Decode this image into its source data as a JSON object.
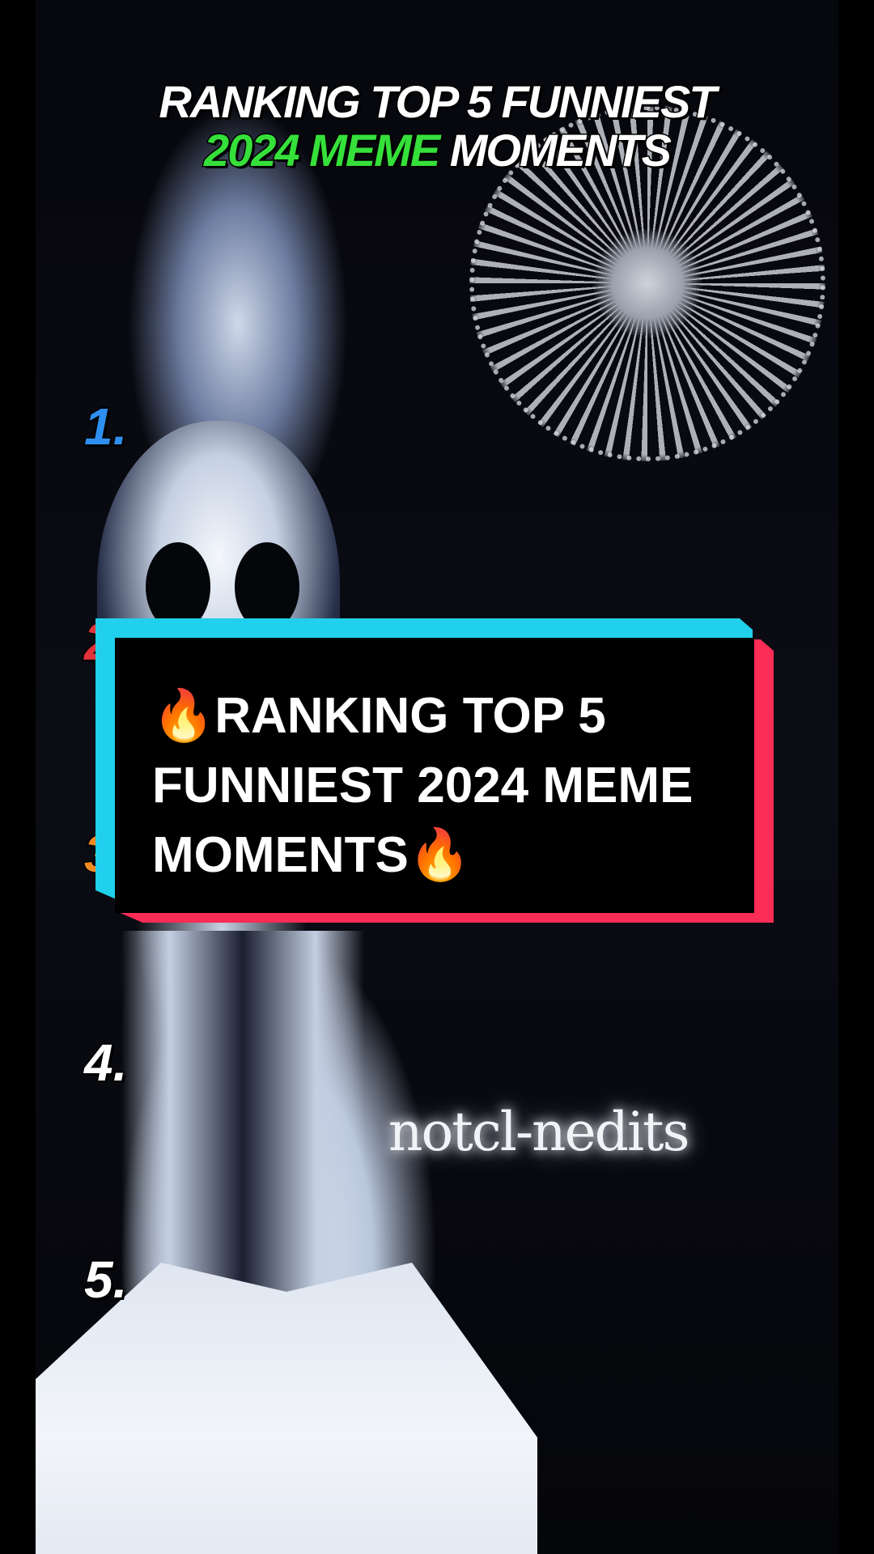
{
  "header": {
    "line1": "RANKING TOP 5 FUNNIEST",
    "line2_highlight": "2024 MEME",
    "line2_rest": " MOMENTS"
  },
  "ranks": [
    "1.",
    "2",
    "3",
    "4.",
    "5."
  ],
  "caption": {
    "emoji_start": "🔥",
    "text": "RANKING TOP 5 FUNNIEST 2024 MEME MOMENTS",
    "emoji_end": "🔥"
  },
  "watermark": "notcl-nedits",
  "colors": {
    "highlight": "#35e03a",
    "caption_cyan": "#21d0ec",
    "caption_red": "#fb2c55",
    "rank1": "#2f8ff0"
  }
}
